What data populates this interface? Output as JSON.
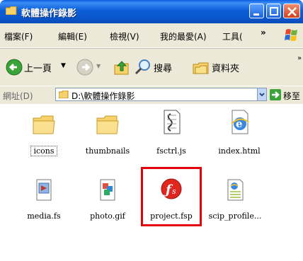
{
  "window": {
    "title": "軟體操作錄影"
  },
  "menu": {
    "items": [
      "檔案(F)",
      "編輯(E)",
      "檢視(V)",
      "我的最愛(A)",
      "工具("
    ],
    "overflow": "»"
  },
  "toolbar": {
    "back": "上一頁",
    "search": "搜尋",
    "folders": "資料夾",
    "overflow": "»"
  },
  "address": {
    "label": "網址(D)",
    "path": "D:\\軟體操作錄影",
    "go": "移至"
  },
  "files": [
    {
      "name": "icons",
      "icon": "folder-icon"
    },
    {
      "name": "thumbnails",
      "icon": "folder-icon"
    },
    {
      "name": "fsctrl.js",
      "icon": "script-file-icon"
    },
    {
      "name": "index.html",
      "icon": "ie-html-icon"
    },
    {
      "name": "media.fs",
      "icon": "media-file-icon"
    },
    {
      "name": "photo.gif",
      "icon": "image-file-icon"
    },
    {
      "name": "project.fsp",
      "icon": "flash-project-icon"
    },
    {
      "name": "scip_profile...",
      "icon": "xml-file-icon"
    }
  ],
  "colors": {
    "titlebar": "#0a5fe0",
    "chrome": "#ece9d8",
    "highlight": "#e3000b"
  }
}
